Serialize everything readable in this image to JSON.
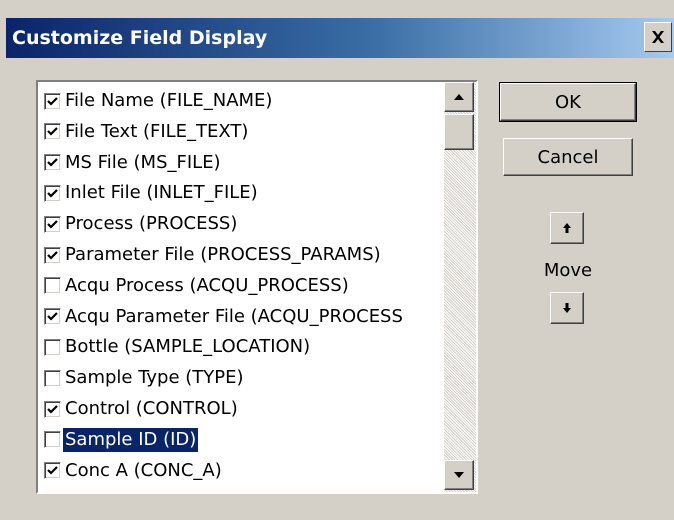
{
  "dialog": {
    "title": "Customize Field Display",
    "close_glyph": "close-icon"
  },
  "fields": [
    {
      "label": "File Name (FILE_NAME)",
      "checked": true,
      "selected": false
    },
    {
      "label": "File Text (FILE_TEXT)",
      "checked": true,
      "selected": false
    },
    {
      "label": "MS File (MS_FILE)",
      "checked": true,
      "selected": false
    },
    {
      "label": "Inlet File (INLET_FILE)",
      "checked": true,
      "selected": false
    },
    {
      "label": "Process (PROCESS)",
      "checked": true,
      "selected": false
    },
    {
      "label": "Parameter File (PROCESS_PARAMS)",
      "checked": true,
      "selected": false
    },
    {
      "label": "Acqu Process (ACQU_PROCESS)",
      "checked": false,
      "selected": false
    },
    {
      "label": "Acqu Parameter File (ACQU_PROCESS",
      "checked": true,
      "selected": false
    },
    {
      "label": "Bottle (SAMPLE_LOCATION)",
      "checked": false,
      "selected": false
    },
    {
      "label": "Sample Type (TYPE)",
      "checked": false,
      "selected": false
    },
    {
      "label": "Control (CONTROL)",
      "checked": true,
      "selected": false
    },
    {
      "label": "Sample ID (ID)",
      "checked": false,
      "selected": true
    },
    {
      "label": "Conc A (CONC_A)",
      "checked": true,
      "selected": false
    }
  ],
  "buttons": {
    "ok": "OK",
    "cancel": "Cancel",
    "move_label": "Move"
  },
  "colors": {
    "title_gradient_start": "#0a246a",
    "title_gradient_end": "#a6caf0",
    "selection": "#0a246a",
    "face": "#d4d0c8"
  }
}
